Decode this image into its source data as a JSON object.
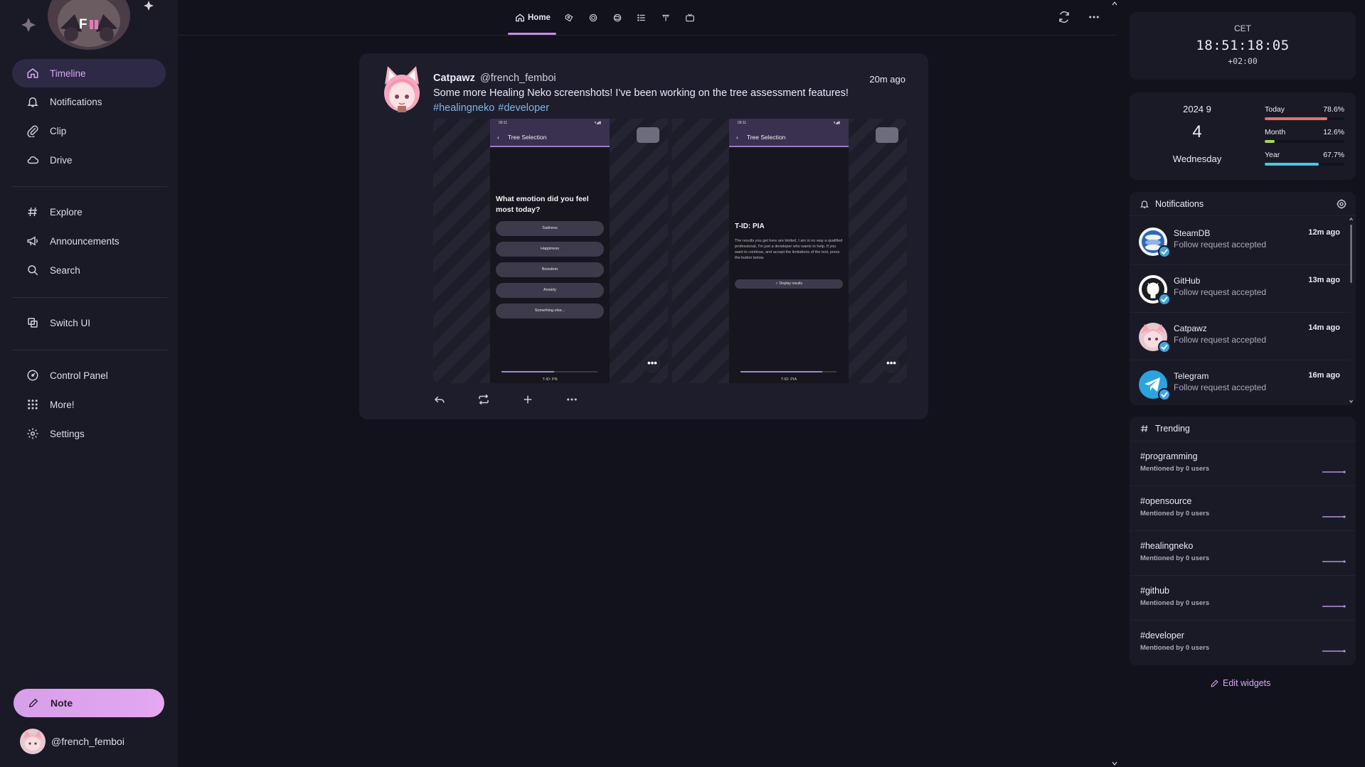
{
  "sidebar": {
    "items": [
      {
        "label": "Timeline",
        "icon": "home-icon"
      },
      {
        "label": "Notifications",
        "icon": "bell-icon"
      },
      {
        "label": "Clip",
        "icon": "paperclip-icon"
      },
      {
        "label": "Drive",
        "icon": "cloud-icon"
      },
      {
        "label": "Explore",
        "icon": "hash-icon"
      },
      {
        "label": "Announcements",
        "icon": "megaphone-icon"
      },
      {
        "label": "Search",
        "icon": "search-icon"
      },
      {
        "label": "Switch UI",
        "icon": "switch-ui-icon"
      },
      {
        "label": "Control Panel",
        "icon": "dashboard-icon"
      },
      {
        "label": "More!",
        "icon": "grid-icon"
      },
      {
        "label": "Settings",
        "icon": "gear-icon"
      }
    ],
    "note_label": "Note",
    "account_handle": "@french_femboi",
    "logo_text": "F"
  },
  "topbar": {
    "home_label": "Home"
  },
  "post": {
    "author": "Catpawz",
    "handle": "@french_femboi",
    "time": "20m ago",
    "text": "Some more Healing Neko screenshots! I've been working on the tree assessment features!",
    "tags": [
      "#healingneko",
      "#developer"
    ],
    "media1": {
      "status_time": "09:11",
      "header": "Tree Selection",
      "question": "What emotion did you feel most today?",
      "options": [
        "Sadness",
        "Happiness",
        "Boredom",
        "Anxiety",
        "Something else..."
      ],
      "footer": "T-ID: PN",
      "progress": 0.55
    },
    "media2": {
      "status_time": "09:11",
      "header": "Tree Selection",
      "title": "T-ID: PIA",
      "body": "The results you get here are limited. I am in no way a qualified professional, I'm just a developer who wants to help. If you want to continue, and accept the limitations of the tool, press the button below.",
      "button": "✓ Display results",
      "footer": "T-ID: PIA",
      "progress": 0.85
    },
    "more_glyph": "•••"
  },
  "clock": {
    "timezone": "CET",
    "time": "18:51:18:05",
    "offset": "+02:00"
  },
  "calendar": {
    "year_month": "2024 9",
    "day": "4",
    "weekday": "Wednesday",
    "progress": [
      {
        "label": "Today",
        "percent_text": "78.6%",
        "value": 0.786,
        "color": "#e8735f"
      },
      {
        "label": "Month",
        "percent_text": "12.6%",
        "value": 0.126,
        "color": "#a6d94c"
      },
      {
        "label": "Year",
        "percent_text": "67.7%",
        "value": 0.677,
        "color": "#4ac7e0"
      }
    ]
  },
  "notifications": {
    "title": "Notifications",
    "items": [
      {
        "name": "SteamDB",
        "text": "Follow request accepted",
        "time": "12m ago"
      },
      {
        "name": "GitHub",
        "text": "Follow request accepted",
        "time": "13m ago"
      },
      {
        "name": "Catpawz",
        "text": "Follow request accepted",
        "time": "14m ago"
      },
      {
        "name": "Telegram",
        "text": "Follow request accepted",
        "time": "16m ago"
      }
    ]
  },
  "trending": {
    "title": "Trending",
    "items": [
      {
        "tag": "#programming",
        "mentions": "Mentioned by 0 users"
      },
      {
        "tag": "#opensource",
        "mentions": "Mentioned by 0 users"
      },
      {
        "tag": "#healingneko",
        "mentions": "Mentioned by 0 users"
      },
      {
        "tag": "#github",
        "mentions": "Mentioned by 0 users"
      },
      {
        "tag": "#developer",
        "mentions": "Mentioned by 0 users"
      }
    ]
  },
  "edit_widgets_label": "Edit widgets",
  "colors": {
    "accent": "#d6a9f2",
    "link": "#7fb6e8",
    "background": "#12121d",
    "panel": "#1a1a27"
  }
}
